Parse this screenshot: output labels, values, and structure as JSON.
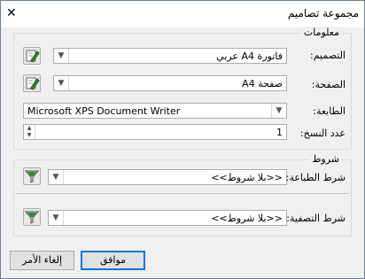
{
  "window": {
    "title": "مجموعة تصاميم",
    "close_glyph": "✕"
  },
  "info_group": {
    "legend": "معلومات",
    "design": {
      "label": "التصميم:",
      "value": "فاتورة A4 عربي"
    },
    "page": {
      "label": "الصفحة:",
      "value": "صفحة A4"
    },
    "printer": {
      "label": "الطابعة:",
      "value": "Microsoft XPS Document Writer"
    },
    "copies": {
      "label": "عدد النسخ:",
      "value": "1"
    }
  },
  "conditions_group": {
    "legend": "شروط",
    "print_condition": {
      "label": "شرط الطباعة:",
      "value": "<<بلا شروط>>"
    },
    "filter_condition": {
      "label": "شرط التصفية:",
      "value": "<<بلا شروط>>"
    }
  },
  "buttons": {
    "ok": "موافق",
    "cancel": "إلغاء الأمر"
  },
  "icons": {
    "edit": "edit-pencil-icon",
    "filter": "filter-funnel-icon",
    "dropdown": "chevron-down-icon"
  },
  "colors": {
    "default_button_border": "#0078d7",
    "icon_pencil": "#2e8b2e",
    "icon_paper": "#ffffff"
  }
}
